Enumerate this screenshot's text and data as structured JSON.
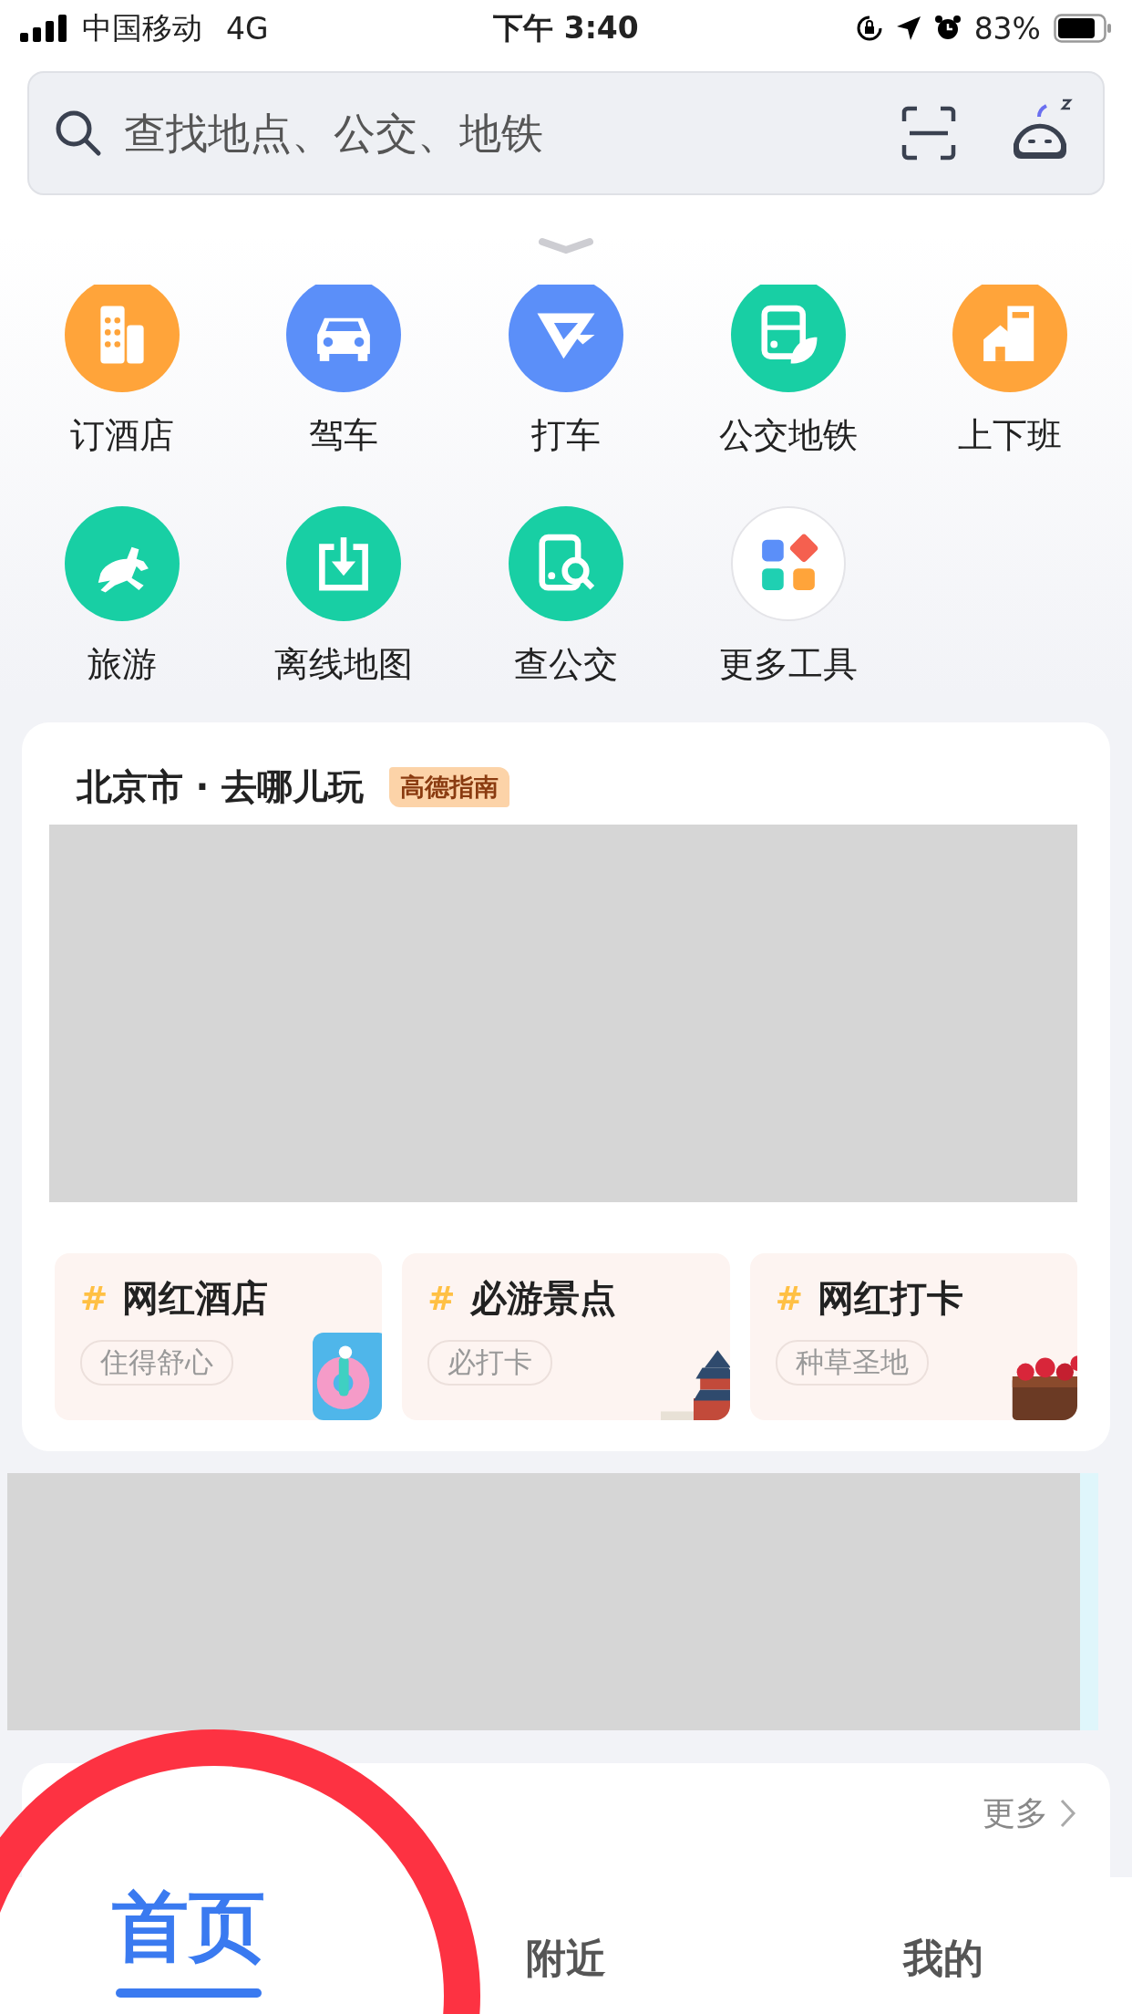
{
  "status_bar": {
    "carrier": "中国移动",
    "network": "4G",
    "time": "下午 3:40",
    "battery": "83%"
  },
  "search": {
    "placeholder": "查找地点、公交、地铁"
  },
  "tools": [
    {
      "label": "订酒店",
      "kind": "hotel",
      "color": "#ffa43a"
    },
    {
      "label": "驾车",
      "kind": "car",
      "color": "#5b8ff9"
    },
    {
      "label": "打车",
      "kind": "taxi",
      "color": "#5b8ff9"
    },
    {
      "label": "公交地铁",
      "kind": "bus",
      "color": "#18cfa4"
    },
    {
      "label": "上下班",
      "kind": "commute",
      "color": "#ffa43a"
    },
    {
      "label": "旅游",
      "kind": "travel",
      "color": "#18cfa4"
    },
    {
      "label": "离线地图",
      "kind": "download",
      "color": "#18cfa4"
    },
    {
      "label": "查公交",
      "kind": "busquery",
      "color": "#18cfa4"
    },
    {
      "label": "更多工具",
      "kind": "more",
      "color": "#ffffff"
    }
  ],
  "guide_card": {
    "title": "北京市 · 去哪儿玩",
    "badge": "高德指南",
    "topics": [
      {
        "title": "网红酒店",
        "tag": "住得舒心",
        "hash": "#"
      },
      {
        "title": "必游景点",
        "tag": "必打卡",
        "hash": "#"
      },
      {
        "title": "网红打卡",
        "tag": "种草圣地",
        "hash": "#"
      }
    ]
  },
  "next_card": {
    "more": "更多"
  },
  "tabs": [
    {
      "label": "首页",
      "selected": true
    },
    {
      "label": "附近",
      "selected": false
    },
    {
      "label": "我的",
      "selected": false
    }
  ]
}
